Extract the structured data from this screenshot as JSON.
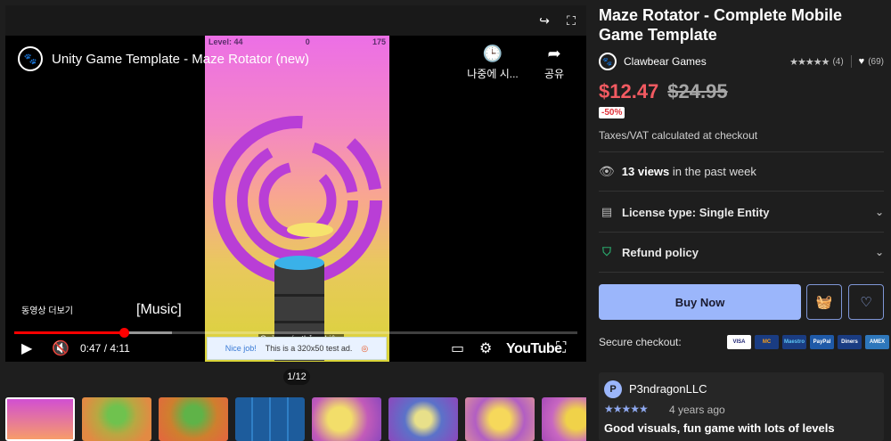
{
  "product": {
    "title": "Maze Rotator - Complete Mobile Game Template",
    "seller": "Clawbear Games",
    "rating_count": "(4)",
    "favorites": "(69)",
    "price_now": "$12.47",
    "price_old": "$24.95",
    "discount": "-50%",
    "tax_note": "Taxes/VAT calculated at checkout",
    "views_count": "13 views",
    "views_suffix": "in the past week",
    "license": "License type: Single Entity",
    "refund": "Refund policy",
    "buy_label": "Buy Now",
    "secure_label": "Secure checkout:",
    "payment_methods": [
      "VISA",
      "MC",
      "Maestro",
      "PayPal",
      "Diners",
      "AMEX"
    ]
  },
  "review": {
    "avatar_letter": "P",
    "author": "P3ndragonLLC",
    "stars": "★★★★★",
    "time": "4 years ago",
    "title": "Good visuals, fun game with lots of levels"
  },
  "video": {
    "title": "Unity Game Template - Maze Rotator (new)",
    "watch_later": "나중에 시...",
    "share": "공유",
    "more_videos": "동영상 더보기",
    "caption": "[Music]",
    "time": "0:47 / 4:11",
    "progress_fraction": 0.195,
    "buffered_fraction": 0.28,
    "ad_label": "Quảng cáo thử nghiệm",
    "ad_text_left": "Nice job!",
    "ad_text": "This is a 320x50 test ad.",
    "game_level": "Level: 44",
    "game_score": "0",
    "game_coins": "175",
    "brand": "YouTube"
  },
  "gallery": {
    "counter": "1/12",
    "thumb_count": 8
  },
  "colors": {
    "accent": "#9bb6fb",
    "price": "#f25a61",
    "background": "#1e1e1e"
  }
}
